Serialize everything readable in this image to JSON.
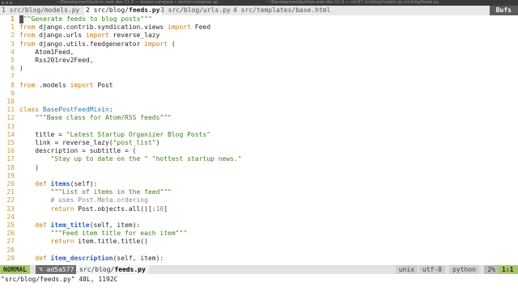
{
  "window": {
    "title_left": "~/Development/python-web-dev-11-3 — docker-compose • docker-compose up",
    "title_mid": "~/Development/python-web-dev-11-3 — vim37 src/blog/models.py src/blog/feeds.py"
  },
  "tabs": [
    {
      "num": "1",
      "label": "src/blog/models.py",
      "active": false
    },
    {
      "num": "2",
      "label": "feeds.py",
      "prefix": "src/blog/",
      "active": true
    },
    {
      "num": "3",
      "label": "src/blog/urls.py",
      "active": false
    },
    {
      "num": "4",
      "label": "src/templates/base.html",
      "active": false
    }
  ],
  "bufs_label": "Bufs",
  "lines": [
    {
      "n": "1",
      "html": "<span class='cursor'></span><span class='str'>\"\"Generate feeds to blog posts\"\"\"</span>"
    },
    {
      "n": "1",
      "html": "<span class='kw'>from</span> django.contrib.syndication.views <span class='kw'>import</span> Feed"
    },
    {
      "n": "2",
      "html": "<span class='kw'>from</span> django.urls <span class='kw'>import</span> reverse_lazy"
    },
    {
      "n": "3",
      "html": "<span class='kw'>from</span> django.utils.feedgenerator <span class='kw'>import</span> ("
    },
    {
      "n": "4",
      "html": "    Atom1Feed,"
    },
    {
      "n": "5",
      "html": "    Rss201rev2Feed,"
    },
    {
      "n": "6",
      "html": ")"
    },
    {
      "n": "7",
      "html": ""
    },
    {
      "n": "8",
      "html": "<span class='kw'>from</span> .models <span class='kw'>import</span> Post"
    },
    {
      "n": "9",
      "html": ""
    },
    {
      "n": "10",
      "html": ""
    },
    {
      "n": "11",
      "html": "<span class='kw'>class</span> <span class='cls'>BasePostFeedMixin</span>:"
    },
    {
      "n": "12",
      "html": "    <span class='str'>\"\"\"Base class for Atom/RSS feeds\"\"\"</span>"
    },
    {
      "n": "13",
      "html": ""
    },
    {
      "n": "14",
      "html": "    title = <span class='str'>\"Latest Startup Organizer Blog Posts\"</span>"
    },
    {
      "n": "15",
      "html": "    link = reverse_lazy(<span class='str'>\"post_list\"</span>)"
    },
    {
      "n": "16",
      "html": "    description = subtitle = ("
    },
    {
      "n": "17",
      "html": "        <span class='str'>\"Stay up to date on the \"</span> <span class='str'>\"hottest startup news.\"</span>"
    },
    {
      "n": "18",
      "html": "    )"
    },
    {
      "n": "19",
      "html": ""
    },
    {
      "n": "20",
      "html": "    <span class='kw'>def</span> <span class='fn'>items</span>(self):"
    },
    {
      "n": "21",
      "html": "        <span class='str'>\"\"\"List of items in the feed\"\"\"</span>"
    },
    {
      "n": "22",
      "html": "        <span class='cm'># uses Post.Meta.ordering</span>"
    },
    {
      "n": "23",
      "html": "        <span class='kw'>return</span> Post.objects.all()[:<span class='num'>10</span>]"
    },
    {
      "n": "24",
      "html": ""
    },
    {
      "n": "25",
      "html": "    <span class='kw'>def</span> <span class='fn'>item_title</span>(self, item):"
    },
    {
      "n": "26",
      "html": "        <span class='str'>\"\"\"Feed item title for each item\"\"\"</span>"
    },
    {
      "n": "27",
      "html": "        <span class='kw'>return</span> item.title.title()"
    },
    {
      "n": "28",
      "html": ""
    },
    {
      "n": "29",
      "html": "    <span class='kw'>def</span> <span class='fn'>item_description</span>(self, item):"
    }
  ],
  "status": {
    "mode": "NORMAL",
    "branch": "ad5a577",
    "file_prefix": "src/blog/",
    "file_name": "feeds.py",
    "format": "unix",
    "encoding": "utf-8",
    "filetype": "python",
    "percent": "2%",
    "position": "1:1"
  },
  "cmdline": "\"src/blog/feeds.py\" 48L, 1192C"
}
